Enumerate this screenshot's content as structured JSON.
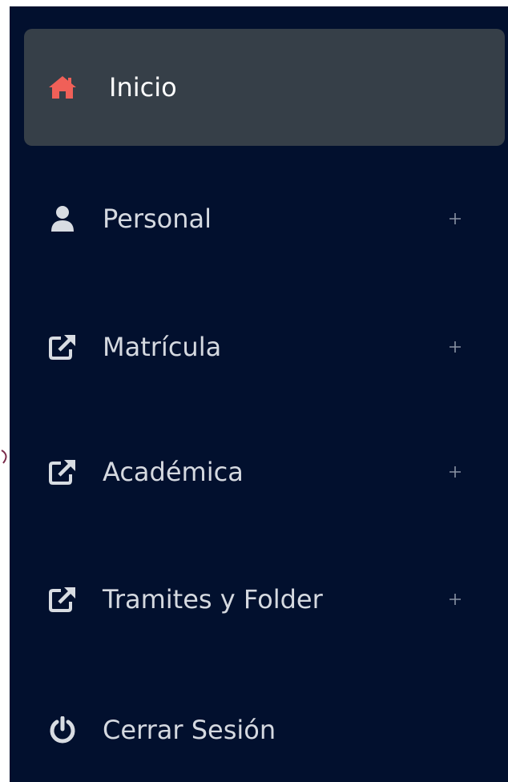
{
  "colors": {
    "sidebar_bg": "#02102e",
    "active_bg": "#363f48",
    "home_icon": "#f06058",
    "text": "#d5d9e0",
    "icon": "#d8dce2",
    "expander": "#8a93a3",
    "stray_mark": "#7a2a4a"
  },
  "menu": {
    "items": [
      {
        "label": "Inicio",
        "icon": "home-icon",
        "active": true
      },
      {
        "label": "Personal",
        "icon": "user-icon",
        "expander": "plus-icon"
      },
      {
        "label": "Matrícula",
        "icon": "external-link-icon",
        "expander": "plus-icon"
      },
      {
        "label": "Académica",
        "icon": "external-link-icon",
        "expander": "plus-icon"
      },
      {
        "label": "Tramites y Folder",
        "icon": "external-link-icon",
        "expander": "plus-icon"
      },
      {
        "label": "Cerrar Sesión",
        "icon": "power-icon"
      }
    ]
  }
}
